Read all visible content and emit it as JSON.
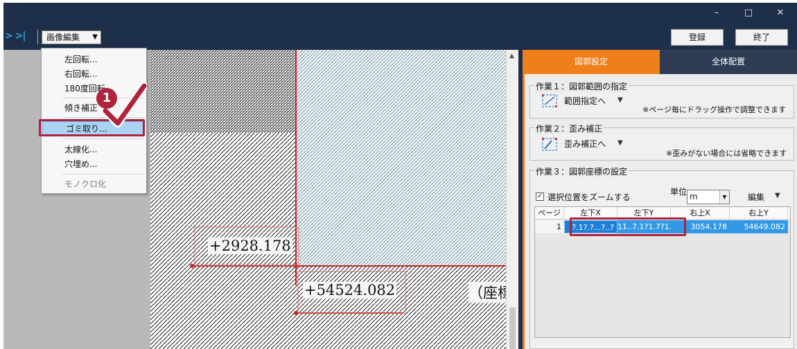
{
  "window": {
    "minimize_glyph": "–",
    "maximize_glyph": "□",
    "close_glyph": "✕"
  },
  "toolbar": {
    "nav_arrows": "> >|",
    "image_edit_menu": "画像編集",
    "register_label": "登録",
    "end_label": "終了"
  },
  "image_edit_menu": {
    "items": [
      {
        "label": "左回転..."
      },
      {
        "label": "右回転..."
      },
      {
        "label": "180度回転"
      },
      {
        "label": "傾き補正"
      },
      {
        "label": "ゴミ取り..."
      },
      {
        "label": "太線化..."
      },
      {
        "label": "穴埋め..."
      },
      {
        "label": "モノクロ化"
      }
    ],
    "selected_item": "ゴミ取り...",
    "disabled_item": "モノクロ化"
  },
  "callout": {
    "step_number": "1"
  },
  "viewport": {
    "coord_x_text": "+2928.178",
    "coord_y_text": "+54524.082",
    "coord_partial_text": "（座標"
  },
  "panel": {
    "tabs": [
      {
        "label": "図郭設定",
        "active": true
      },
      {
        "label": "全体配置",
        "active": false
      }
    ],
    "task1": {
      "title": "作業１：図郭範囲の指定",
      "tool_label": "範囲指定へ",
      "note": "※ページ毎にドラッグ操作で調整できます"
    },
    "task2": {
      "title": "作業２：歪み補正",
      "tool_label": "歪み補正へ",
      "note": "※歪みがない場合には省略できます"
    },
    "task3": {
      "title": "作業３：図郭座標の設定",
      "zoom_checkbox_label": "選択位置をズームする",
      "zoom_checkbox_checked": true,
      "unit_label": "単位",
      "unit_value": "m",
      "edit_label": "編集",
      "columns": [
        "ページ",
        "左下X",
        "左下Y",
        "右上X",
        "右上Y"
      ],
      "rows": [
        {
          "page": "1",
          "lower_left_x": "?.1?.?...?..?",
          "lower_left_y": "11..7.1?1.7?1..",
          "upper_right_x": "3054.178",
          "upper_right_y": "54649.082"
        }
      ]
    }
  },
  "colors": {
    "title_bar": "#1e2f4a",
    "active_tab": "#f07e1a",
    "inactive_tab": "#2e3d55",
    "highlight": "#b0233c",
    "selection": "#3399e6",
    "menu_selected": "#a9d2f3"
  }
}
